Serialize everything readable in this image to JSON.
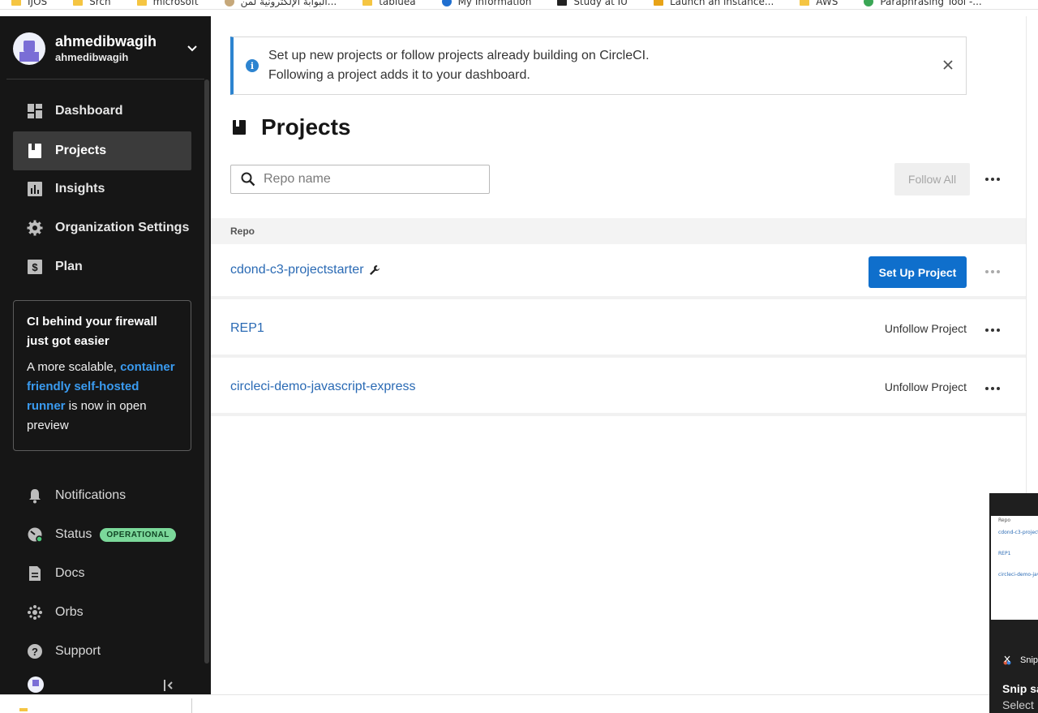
{
  "bookmarks": [
    {
      "label": "IJOS",
      "icon": "folder-icon"
    },
    {
      "label": "Srch",
      "icon": "folder-icon"
    },
    {
      "label": "microsoft",
      "icon": "folder-icon"
    },
    {
      "label": "البوابة الإلكترونية لمن...",
      "icon": "globe-icon"
    },
    {
      "label": "tabluea",
      "icon": "folder-icon"
    },
    {
      "label": "My Information",
      "icon": "azure-icon"
    },
    {
      "label": "Study at IU",
      "icon": "iu-icon"
    },
    {
      "label": "Launch an instance...",
      "icon": "aws-icon"
    },
    {
      "label": "AWS",
      "icon": "folder-icon"
    },
    {
      "label": "Paraphrasing Tool -...",
      "icon": "quillbot-icon"
    }
  ],
  "user": {
    "name": "ahmedibwagih",
    "org": "ahmedibwagih"
  },
  "sidebar": {
    "items": [
      {
        "label": "Dashboard",
        "icon": "dashboard-icon"
      },
      {
        "label": "Projects",
        "icon": "projects-icon",
        "active": true
      },
      {
        "label": "Insights",
        "icon": "insights-icon"
      },
      {
        "label": "Organization Settings",
        "icon": "gear-icon"
      },
      {
        "label": "Plan",
        "icon": "dollar-icon"
      }
    ],
    "bottom_items": [
      {
        "label": "Notifications",
        "icon": "bell-icon"
      },
      {
        "label": "Status",
        "icon": "gauge-icon",
        "badge": "OPERATIONAL"
      },
      {
        "label": "Docs",
        "icon": "doc-icon"
      },
      {
        "label": "Orbs",
        "icon": "orbs-icon"
      },
      {
        "label": "Support",
        "icon": "help-icon"
      }
    ]
  },
  "promo": {
    "title": "CI behind your firewall just got easier",
    "body_before": "A more scalable, ",
    "link": "container friendly self-hosted runner",
    "body_after": " is now in open preview"
  },
  "banner": {
    "line1": "Set up new projects or follow projects already building on CircleCI.",
    "line2": "Following a project adds it to your dashboard."
  },
  "page": {
    "title": "Projects"
  },
  "search": {
    "placeholder": "Repo name"
  },
  "follow_all_label": "Follow All",
  "table": {
    "header": "Repo",
    "rows": [
      {
        "name": "cdond-c3-projectstarter",
        "action": "Set Up Project"
      },
      {
        "name": "REP1",
        "action": "Unfollow Project"
      },
      {
        "name": "circleci-demo-javascript-express",
        "action": "Unfollow Project"
      }
    ]
  },
  "snip": {
    "thumb_header": "Repo",
    "thumb_rows": [
      "cdond-c3-projectst",
      "REP1",
      "circleci-demo-java"
    ],
    "app": "Snip",
    "title": "Snip sa",
    "subtitle": "Select"
  },
  "colors": {
    "sidebar_bg": "#161616",
    "accent_blue": "#0f6fcc",
    "link_blue": "#2a6ab4",
    "status_green": "#7bd89a"
  }
}
